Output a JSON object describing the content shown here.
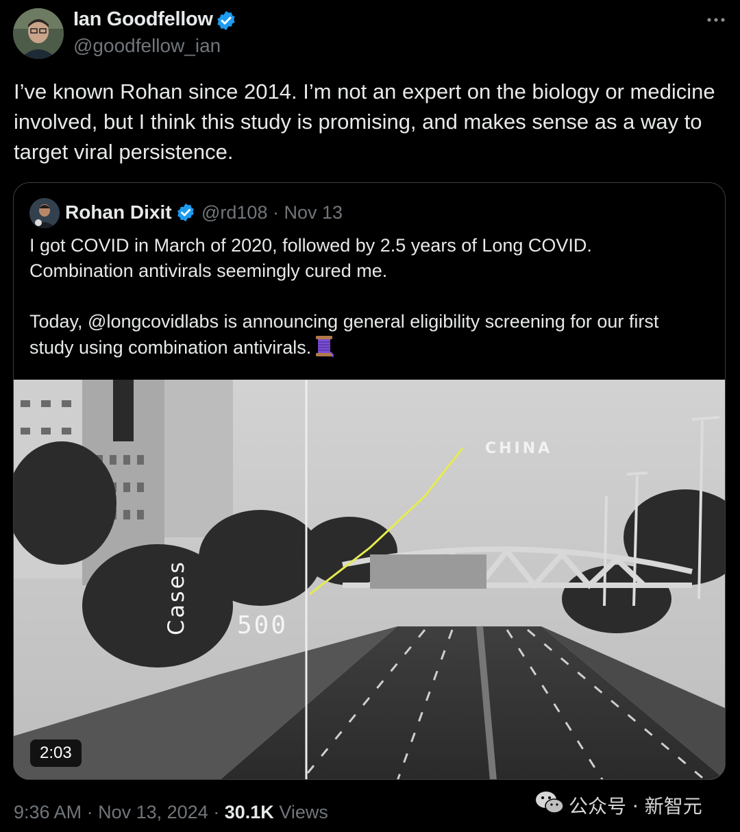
{
  "author": {
    "name": "Ian Goodfellow",
    "handle": "@goodfellow_ian",
    "verified": true
  },
  "tweet_text": "I’ve known Rohan since 2014. I’m not an expert on the biology or medicine involved, but I think this study is promising, and makes sense as a way to target viral persistence.",
  "quoted": {
    "name": "Rohan Dixit",
    "handle": "@rd108",
    "separator": "·",
    "date": "Nov 13",
    "text": "I got COVID in March of 2020, followed by 2.5 years of Long COVID.\nCombination antivirals seemingly cured me.\n\nToday, @longcovidlabs is announcing general eligibility screening for our first study using combination antivirals.",
    "thread_icon": "thread-spool-icon",
    "video": {
      "duration": "2:03",
      "overlay_label_region": "CHINA",
      "overlay_axis_label": "Cases",
      "overlay_value": "500"
    }
  },
  "footer": {
    "time": "9:36 AM",
    "sep1": "·",
    "date": "Nov 13, 2024",
    "sep2": "·",
    "views_count": "30.1K",
    "views_label": "Views"
  },
  "watermark": {
    "text": "公众号 · 新智元",
    "icon": "wechat-icon"
  },
  "colors": {
    "background": "#000000",
    "text": "#e7e9ea",
    "muted": "#71767b",
    "verified": "#1d9bf0",
    "border": "#3a3d41",
    "overlay_line": "#e5ec4e"
  }
}
